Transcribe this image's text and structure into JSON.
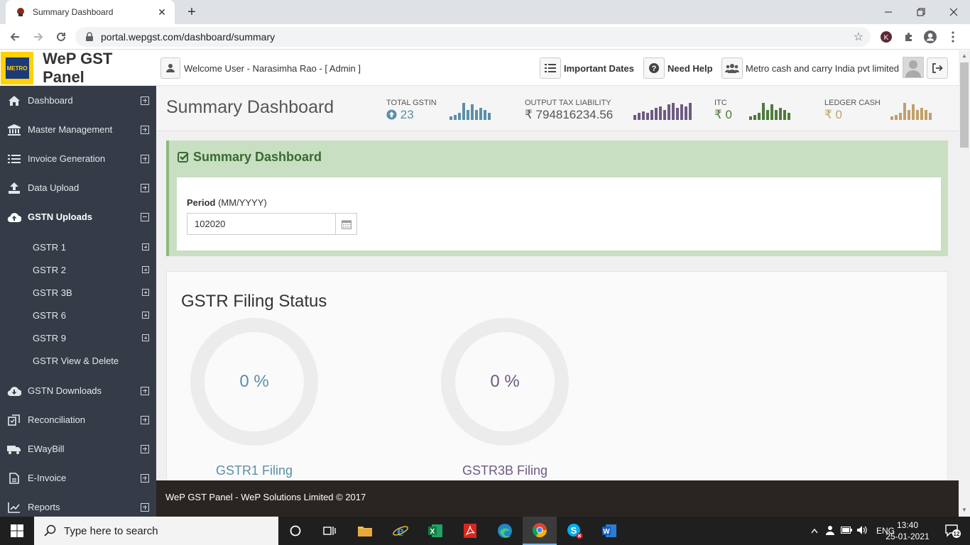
{
  "browser": {
    "tab_title": "Summary Dashboard",
    "url": "portal.wepgst.com/dashboard/summary",
    "profile_initial": "K"
  },
  "header": {
    "brand": "WeP GST Panel",
    "logo_text": "METRO",
    "welcome": "Welcome User - Narasimha Rao - [ Admin ]",
    "important_dates": "Important Dates",
    "need_help": "Need Help",
    "company": "Metro cash and carry India pvt limited"
  },
  "sidebar": {
    "items": [
      {
        "label": "Dashboard",
        "icon": "home-icon"
      },
      {
        "label": "Master Management",
        "icon": "bank-icon"
      },
      {
        "label": "Invoice Generation",
        "icon": "list-icon"
      },
      {
        "label": "Data Upload",
        "icon": "upload-icon"
      },
      {
        "label": "GSTN Uploads",
        "icon": "cloud-upload-icon"
      },
      {
        "label": "GSTN Downloads",
        "icon": "cloud-download-icon"
      },
      {
        "label": "Reconciliation",
        "icon": "reconcile-icon"
      },
      {
        "label": "EWayBill",
        "icon": "truck-icon"
      },
      {
        "label": "E-Invoice",
        "icon": "document-icon"
      },
      {
        "label": "Reports",
        "icon": "chart-icon"
      }
    ],
    "sub_items": [
      {
        "label": "GSTR 1"
      },
      {
        "label": "GSTR 2"
      },
      {
        "label": "GSTR 3B"
      },
      {
        "label": "GSTR 6"
      },
      {
        "label": "GSTR 9"
      },
      {
        "label": "GSTR View & Delete"
      }
    ]
  },
  "page": {
    "title": "Summary Dashboard",
    "stats": [
      {
        "label": "TOTAL GSTIN",
        "value": "23",
        "color": "#5b8fa8",
        "spark": [
          2,
          3,
          4,
          10,
          6,
          9,
          6,
          7,
          6,
          4
        ]
      },
      {
        "label": "OUTPUT TAX LIABILITY",
        "value": "₹ 794816234.56",
        "color": "#6f5a82",
        "spark": [
          3,
          4,
          5,
          4,
          6,
          7,
          8,
          6,
          9,
          10,
          7,
          9,
          8,
          10
        ]
      },
      {
        "label": "ITC",
        "value": "₹ 0",
        "color": "#4f7a3d",
        "spark": [
          2,
          3,
          4,
          10,
          6,
          9,
          6,
          7,
          6,
          4
        ]
      },
      {
        "label": "LEDGER CASH",
        "value": "₹ 0",
        "color": "#c0a06a",
        "spark": [
          2,
          3,
          4,
          10,
          6,
          9,
          6,
          7,
          6,
          4
        ]
      }
    ],
    "summary_panel_title": "Summary Dashboard",
    "period_label": "Period",
    "period_hint": "(MM/YYYY)",
    "period_value": "102020",
    "filing_title": "GSTR Filing Status",
    "rings": [
      {
        "value": "0 %",
        "label": "GSTR1 Filing",
        "color": "#5b8fa8"
      },
      {
        "value": "0 %",
        "label": "GSTR3B Filing",
        "color": "#6f5a82"
      }
    ]
  },
  "footer": {
    "text": "WeP GST Panel - WeP Solutions Limited © 2017"
  },
  "taskbar": {
    "search_placeholder": "Type here to search",
    "lang": "ENG",
    "time": "13:40",
    "date": "25-01-2021",
    "notification_count": "12"
  }
}
